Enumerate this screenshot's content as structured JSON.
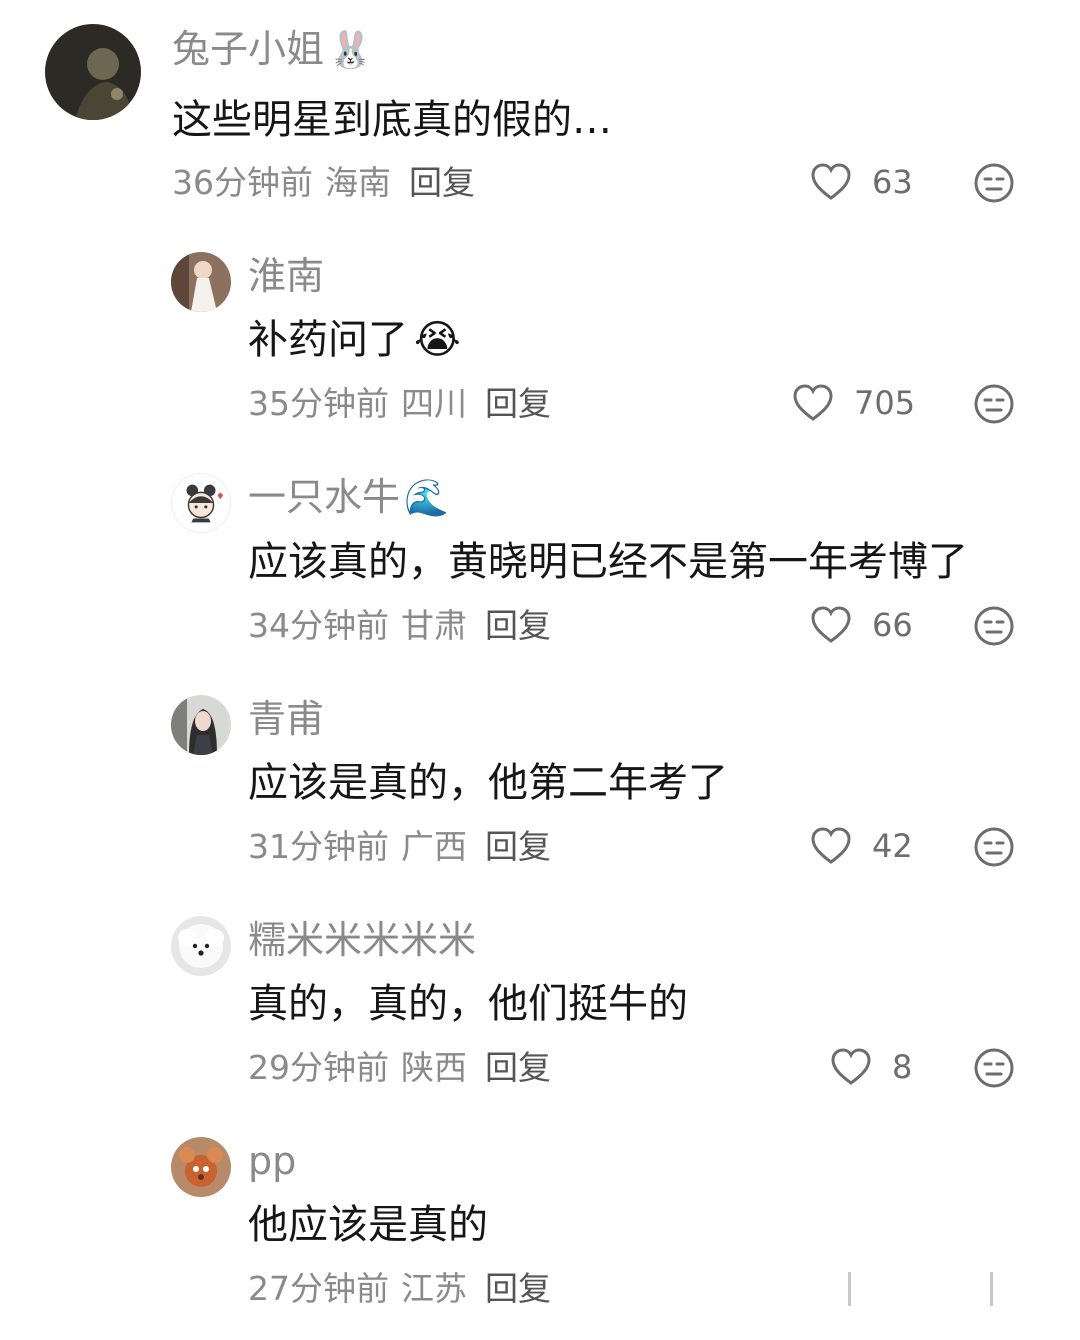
{
  "comments": [
    {
      "username": "兔子小姐",
      "username_emoji": "🐰",
      "content": "这些明星到底真的假的…",
      "content_emoji": "",
      "time": "36分钟前",
      "location": "海南",
      "reply_label": "回复",
      "likes": "63"
    },
    {
      "username": "淮南",
      "username_emoji": "",
      "content": "补药问了",
      "content_emoji": "😭",
      "time": "35分钟前",
      "location": "四川",
      "reply_label": "回复",
      "likes": "705"
    },
    {
      "username": "一只水牛",
      "username_emoji": "🌊",
      "content": "应该真的，黄晓明已经不是第一年考博了",
      "content_emoji": "",
      "time": "34分钟前",
      "location": "甘肃",
      "reply_label": "回复",
      "likes": "66"
    },
    {
      "username": "青甫",
      "username_emoji": "",
      "content": "应该是真的，他第二年考了",
      "content_emoji": "",
      "time": "31分钟前",
      "location": "广西",
      "reply_label": "回复",
      "likes": "42"
    },
    {
      "username": "糯米米米米米",
      "username_emoji": "",
      "content": "真的，真的，他们挺牛的",
      "content_emoji": "",
      "time": "29分钟前",
      "location": "陕西",
      "reply_label": "回复",
      "likes": "8"
    },
    {
      "username": "pp",
      "username_emoji": "",
      "content": "他应该是真的",
      "content_emoji": "",
      "time": "27分钟前",
      "location": "江苏",
      "reply_label": "回复",
      "likes": ""
    }
  ],
  "icons": {
    "like": "heart-outline-icon",
    "dislike": "neutral-face-icon"
  },
  "colors": {
    "username": "#8a8a8a",
    "content": "#161616",
    "meta": "#8a8a8a",
    "icon": "#6d6d6d"
  }
}
